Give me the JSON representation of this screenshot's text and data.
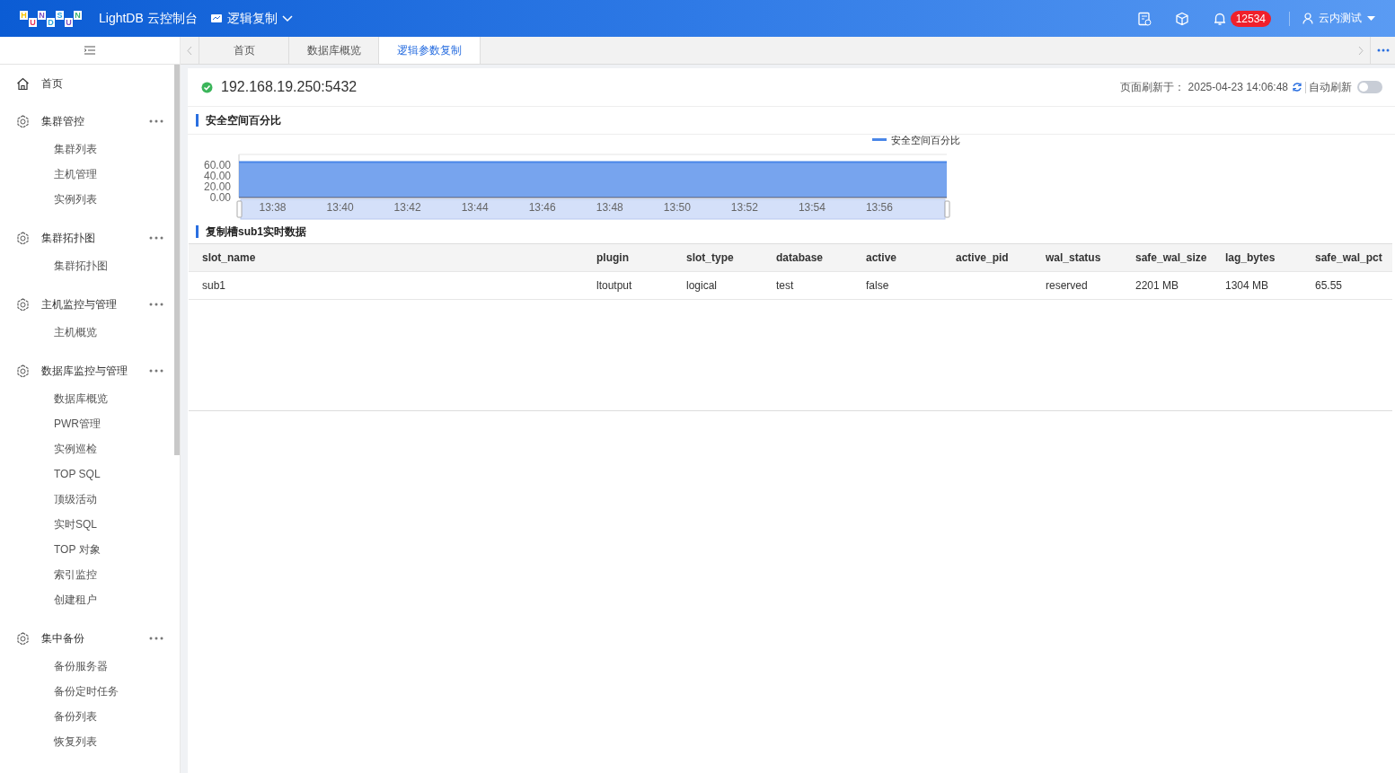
{
  "header": {
    "logo_letters": [
      "H",
      "U",
      "N",
      "D",
      "S",
      "U",
      "N"
    ],
    "title": "LightDB 云控制台",
    "module": "逻辑复制",
    "notification_count": "12534",
    "user": "云内测试"
  },
  "sidebar": {
    "items": [
      {
        "kind": "link",
        "label": "首页"
      },
      {
        "kind": "group",
        "label": "集群管控",
        "children": [
          {
            "label": "集群列表"
          },
          {
            "label": "主机管理"
          },
          {
            "label": "实例列表"
          }
        ]
      },
      {
        "kind": "group",
        "label": "集群拓扑图",
        "children": [
          {
            "label": "集群拓扑图"
          }
        ]
      },
      {
        "kind": "group",
        "label": "主机监控与管理",
        "children": [
          {
            "label": "主机概览"
          }
        ]
      },
      {
        "kind": "group",
        "label": "数据库监控与管理",
        "children": [
          {
            "label": "数据库概览"
          },
          {
            "label": "PWR管理"
          },
          {
            "label": "实例巡检"
          },
          {
            "label": "TOP SQL"
          },
          {
            "label": "顶级活动"
          },
          {
            "label": "实时SQL"
          },
          {
            "label": "TOP 对象"
          },
          {
            "label": "索引监控"
          },
          {
            "label": "创建租户"
          }
        ]
      },
      {
        "kind": "group",
        "label": "集中备份",
        "children": [
          {
            "label": "备份服务器"
          },
          {
            "label": "备份定时任务"
          },
          {
            "label": "备份列表"
          },
          {
            "label": "恢复列表"
          }
        ]
      }
    ]
  },
  "tabs": [
    {
      "label": "首页",
      "selected": false
    },
    {
      "label": "数据库概览",
      "selected": false
    },
    {
      "label": "逻辑参数复制",
      "selected": true
    }
  ],
  "instance": {
    "address": "192.168.19.250:5432",
    "refreshed_label": "页面刷新于：",
    "refreshed_at": "2025-04-23 14:06:48",
    "auto_refresh_label": "自动刷新",
    "auto_refresh": false
  },
  "chart_section": {
    "title": "安全空间百分比",
    "chart_data": {
      "type": "area",
      "categories": [
        null,
        "13:38",
        null,
        "13:40",
        null,
        "13:42",
        null,
        "13:44",
        null,
        "13:46",
        null,
        "13:48",
        null,
        "13:50",
        null,
        "13:52",
        null,
        "13:54",
        null,
        "13:56",
        null,
        null
      ],
      "ylim": [
        0,
        80
      ],
      "yticks": [
        {
          "value": 0,
          "label": "0.00"
        },
        {
          "value": 20,
          "label": "20.00"
        },
        {
          "value": 40,
          "label": "40.00"
        },
        {
          "value": 60,
          "label": "60.00"
        }
      ],
      "series": [
        {
          "name": "安全空间百分比",
          "color": "#4a86e8",
          "values": [
            66,
            66,
            66,
            66,
            66,
            66,
            66,
            66,
            66,
            66,
            66,
            66,
            66,
            66,
            66,
            66,
            66,
            66,
            66,
            66,
            66,
            66
          ]
        }
      ]
    }
  },
  "table_section": {
    "title": "复制槽sub1实时数据",
    "columns": [
      "slot_name",
      "plugin",
      "slot_type",
      "database",
      "active",
      "active_pid",
      "wal_status",
      "safe_wal_size",
      "lag_bytes",
      "safe_wal_pct"
    ],
    "rows": [
      [
        "sub1",
        "ltoutput",
        "logical",
        "test",
        "false",
        "",
        "reserved",
        "2201 MB",
        "1304 MB",
        "65.55"
      ]
    ]
  }
}
